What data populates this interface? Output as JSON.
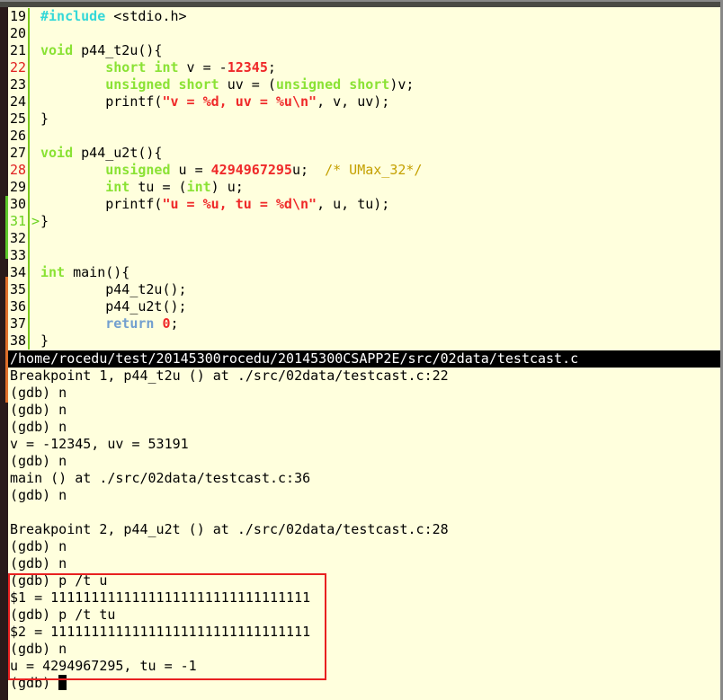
{
  "source_lines": [
    {
      "n": "19",
      "type": "normal",
      "tokens": [
        {
          "t": "#include",
          "c": "pp"
        },
        {
          "t": " <stdio.h>",
          "c": ""
        }
      ]
    },
    {
      "n": "20",
      "type": "normal",
      "tokens": []
    },
    {
      "n": "21",
      "type": "normal",
      "tokens": [
        {
          "t": "void",
          "c": "kw"
        },
        {
          "t": " p44_t2u(){",
          "c": ""
        }
      ]
    },
    {
      "n": "22",
      "type": "breakpoint",
      "tokens": [
        {
          "t": "        ",
          "c": ""
        },
        {
          "t": "short",
          "c": "kw"
        },
        {
          "t": " ",
          "c": ""
        },
        {
          "t": "int",
          "c": "kw"
        },
        {
          "t": " v = -",
          "c": ""
        },
        {
          "t": "12345",
          "c": "num"
        },
        {
          "t": ";",
          "c": ""
        }
      ]
    },
    {
      "n": "23",
      "type": "normal",
      "tokens": [
        {
          "t": "        ",
          "c": ""
        },
        {
          "t": "unsigned",
          "c": "kw"
        },
        {
          "t": " ",
          "c": ""
        },
        {
          "t": "short",
          "c": "kw"
        },
        {
          "t": " uv = (",
          "c": ""
        },
        {
          "t": "unsigned",
          "c": "kw"
        },
        {
          "t": " ",
          "c": ""
        },
        {
          "t": "short",
          "c": "kw"
        },
        {
          "t": ")v;",
          "c": ""
        }
      ]
    },
    {
      "n": "24",
      "type": "normal",
      "tokens": [
        {
          "t": "        printf(",
          "c": ""
        },
        {
          "t": "\"v = %d, uv = %u\\n\"",
          "c": "str"
        },
        {
          "t": ", v, uv);",
          "c": ""
        }
      ]
    },
    {
      "n": "25",
      "type": "normal",
      "tokens": [
        {
          "t": "}",
          "c": ""
        }
      ]
    },
    {
      "n": "26",
      "type": "normal",
      "tokens": []
    },
    {
      "n": "27",
      "type": "normal",
      "tokens": [
        {
          "t": "void",
          "c": "kw"
        },
        {
          "t": " p44_u2t(){",
          "c": ""
        }
      ]
    },
    {
      "n": "28",
      "type": "breakpoint",
      "tokens": [
        {
          "t": "        ",
          "c": ""
        },
        {
          "t": "unsigned",
          "c": "kw"
        },
        {
          "t": " u = ",
          "c": ""
        },
        {
          "t": "4294967295",
          "c": "num"
        },
        {
          "t": "u;  ",
          "c": ""
        },
        {
          "t": "/* UMax_32*/",
          "c": "cm"
        }
      ]
    },
    {
      "n": "29",
      "type": "normal",
      "tokens": [
        {
          "t": "        ",
          "c": ""
        },
        {
          "t": "int",
          "c": "kw"
        },
        {
          "t": " tu = (",
          "c": ""
        },
        {
          "t": "int",
          "c": "kw"
        },
        {
          "t": ") u;",
          "c": ""
        }
      ]
    },
    {
      "n": "30",
      "type": "normal",
      "tokens": [
        {
          "t": "        printf(",
          "c": ""
        },
        {
          "t": "\"u = %u, tu = %d\\n\"",
          "c": "str"
        },
        {
          "t": ", u, tu);",
          "c": ""
        }
      ]
    },
    {
      "n": "31",
      "type": "current",
      "tokens": [
        {
          "t": "}",
          "c": ""
        }
      ]
    },
    {
      "n": "32",
      "type": "normal",
      "tokens": []
    },
    {
      "n": "33",
      "type": "normal",
      "tokens": []
    },
    {
      "n": "34",
      "type": "normal",
      "tokens": [
        {
          "t": "int",
          "c": "kw"
        },
        {
          "t": " main(){",
          "c": ""
        }
      ]
    },
    {
      "n": "35",
      "type": "normal",
      "tokens": [
        {
          "t": "        p44_t2u();",
          "c": ""
        }
      ]
    },
    {
      "n": "36",
      "type": "normal",
      "tokens": [
        {
          "t": "        p44_u2t();",
          "c": ""
        }
      ]
    },
    {
      "n": "37",
      "type": "normal",
      "tokens": [
        {
          "t": "        ",
          "c": ""
        },
        {
          "t": "return",
          "c": "rt"
        },
        {
          "t": " ",
          "c": ""
        },
        {
          "t": "0",
          "c": "num"
        },
        {
          "t": ";",
          "c": ""
        }
      ]
    },
    {
      "n": "38",
      "type": "normal",
      "tokens": [
        {
          "t": "}",
          "c": ""
        }
      ]
    }
  ],
  "current_marker": ">",
  "source_path": "/home/rocedu/test/20145300rocedu/20145300CSAPP2E/src/02data/testcast.c",
  "gdb_output": [
    "Breakpoint 1, p44_t2u () at ./src/02data/testcast.c:22",
    "(gdb) n",
    "(gdb) n",
    "(gdb) n",
    "v = -12345, uv = 53191",
    "(gdb) n",
    "main () at ./src/02data/testcast.c:36",
    "(gdb) n",
    "",
    "Breakpoint 2, p44_u2t () at ./src/02data/testcast.c:28",
    "(gdb) n",
    "(gdb) n",
    "(gdb) p /t u",
    "$1 = 11111111111111111111111111111111",
    "(gdb) p /t tu",
    "$2 = 11111111111111111111111111111111",
    "(gdb) n",
    "u = 4294967295, tu = -1"
  ],
  "prompt": "(gdb) ",
  "colors": {
    "background": "#ffffdd",
    "keyword": "#8ae234",
    "preprocessor": "#34d8d8",
    "literal": "#ef2929",
    "comment": "#c4a000",
    "highlight_box": "#e82020"
  }
}
